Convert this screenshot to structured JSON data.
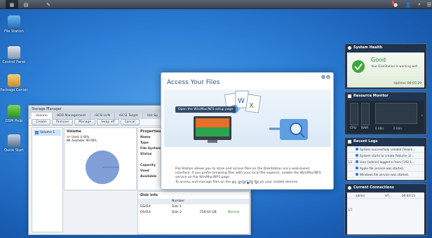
{
  "desktop_icons": [
    {
      "label": "File Station",
      "icon": "folder-search-icon"
    },
    {
      "label": "Control Panel",
      "icon": "control-panel-icon"
    },
    {
      "label": "Package Center",
      "icon": "package-icon"
    },
    {
      "label": "DSM Help",
      "icon": "help-icon"
    },
    {
      "label": "Quick Start",
      "icon": "quick-start-icon"
    }
  ],
  "taskbar": {
    "notif_count": "1"
  },
  "storage_manager": {
    "title": "Storage Manager",
    "tabs": [
      "Volume",
      "HDD Management",
      "iSCSI LUN",
      "iSCSI Target",
      "Hot Sp"
    ],
    "toolbar": [
      "Create",
      "Remove",
      "Manage",
      "Swap off",
      "Cancel"
    ],
    "volume_item": "Volume 1",
    "mid_header": "Volume",
    "legend": [
      {
        "label": "Used: 0.04%",
        "color": "#f2c36b"
      },
      {
        "label": "Available: 99.96%",
        "color": "#7f9fd6"
      }
    ],
    "pie_used_fraction": 0.0004,
    "props_header": "Properties",
    "props": [
      "Name",
      "Type",
      "File System",
      "Status",
      "Capacity",
      "Used",
      "Available"
    ],
    "disk_header": "Disk Info",
    "disk_columns": [
      "",
      "Number",
      ""
    ],
    "disks": [
      {
        "model": "DS414",
        "number": "Disk 1",
        "size": "",
        "status": ""
      },
      {
        "model": "DS414",
        "number": "Disk 2",
        "size": "558.64 GB",
        "status": "Normal"
      }
    ]
  },
  "access_files": {
    "title": "Access Your Files",
    "tip": "Open the Win/Mac/NFS setup page",
    "body": "File Station allows you to store and access files on the DiskStation via a web-based interface. If you prefer browsing files with your local file explorer, enable the Win/Mac/NFS service on the Win/Mac/NFS page.",
    "body2": "To access and manage files on the go, install DS file on your mobile devices.",
    "dots": 5,
    "active_dot": 3
  },
  "widgets": {
    "health": {
      "title": "System Health",
      "status": "Good",
      "desc": "Your DiskStation is working well.",
      "uptime": "Uptime: 00:05:29"
    },
    "resource": {
      "title": "Resource Monitor",
      "cpu": "CPU",
      "ram": "RAM",
      "up": "6 KB/s",
      "down": "0 KB/s"
    },
    "logs": {
      "title": "Recent Logs",
      "page": "1/3",
      "rows": [
        "System successfully created [Volum...",
        "System starts to create [Volume 1]...",
        "User [admin] logged in from [192.1...",
        "Apple file service was started.",
        "Windows file service was started."
      ]
    },
    "connections": {
      "title": "Current Connections",
      "page": "1/1",
      "user": "admin",
      "type": "HT..",
      "time": "00:03:13"
    }
  }
}
